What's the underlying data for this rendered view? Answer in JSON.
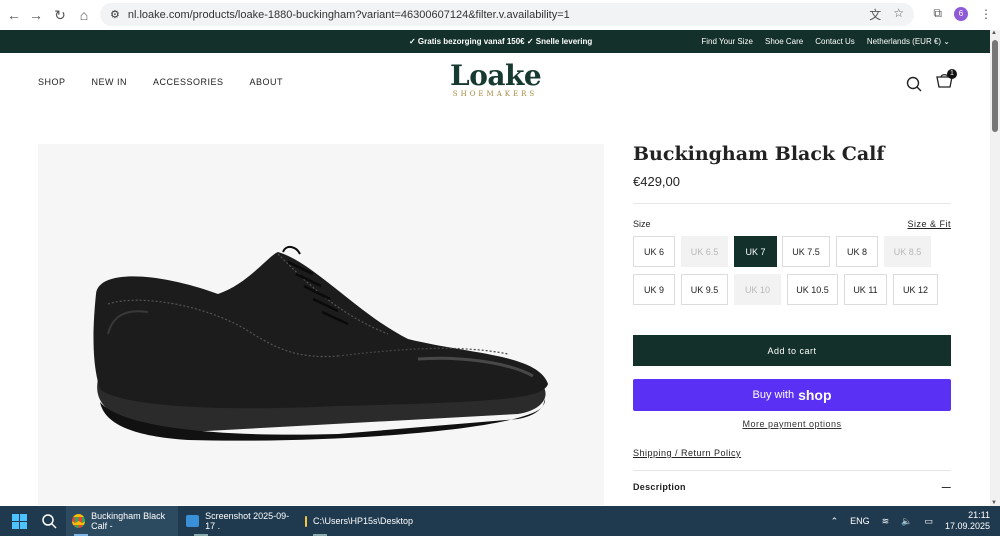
{
  "browser": {
    "url": "nl.loake.com/products/loake-1880-buckingham?variant=46300607124&filter.v.availability=1",
    "profile_initial": "6"
  },
  "announcement": {
    "center_text": "✓ Gratis bezorging vanaf 150€ ✓ Snelle levering",
    "links": [
      "Find Your Size",
      "Shoe Care",
      "Contact Us",
      "Netherlands (EUR €)"
    ]
  },
  "header": {
    "nav": [
      "SHOP",
      "NEW IN",
      "ACCESSORIES",
      "ABOUT"
    ],
    "logo_main": "Loake",
    "logo_sub": "SHOEMAKERS",
    "cart_count": "1"
  },
  "product": {
    "title": "Buckingham Black Calf",
    "price": "€429,00",
    "size_label": "Size",
    "size_fit_link": "Size & Fit",
    "sizes": [
      {
        "label": "UK 6",
        "state": "available"
      },
      {
        "label": "UK 6.5",
        "state": "disabled"
      },
      {
        "label": "UK 7",
        "state": "selected"
      },
      {
        "label": "UK 7.5",
        "state": "available"
      },
      {
        "label": "UK 8",
        "state": "available"
      },
      {
        "label": "UK 8.5",
        "state": "disabled"
      },
      {
        "label": "UK 9",
        "state": "available"
      },
      {
        "label": "UK 9.5",
        "state": "available"
      },
      {
        "label": "UK 10",
        "state": "disabled"
      },
      {
        "label": "UK 10.5",
        "state": "available"
      },
      {
        "label": "UK 11",
        "state": "available"
      },
      {
        "label": "UK 12",
        "state": "available"
      }
    ],
    "add_to_cart": "Add to cart",
    "buy_with": "Buy with",
    "shop_brand": "shop",
    "more_payment": "More payment options",
    "shipping_link": "Shipping / Return Policy",
    "description_label": "Description",
    "description_toggle": "—"
  },
  "taskbar": {
    "items": [
      "Buckingham Black Calf -",
      "Screenshot 2025-09-17 .",
      "C:\\Users\\HP15s\\Desktop"
    ],
    "lang": "ENG",
    "time": "21:11",
    "date": "17.09.2025"
  }
}
